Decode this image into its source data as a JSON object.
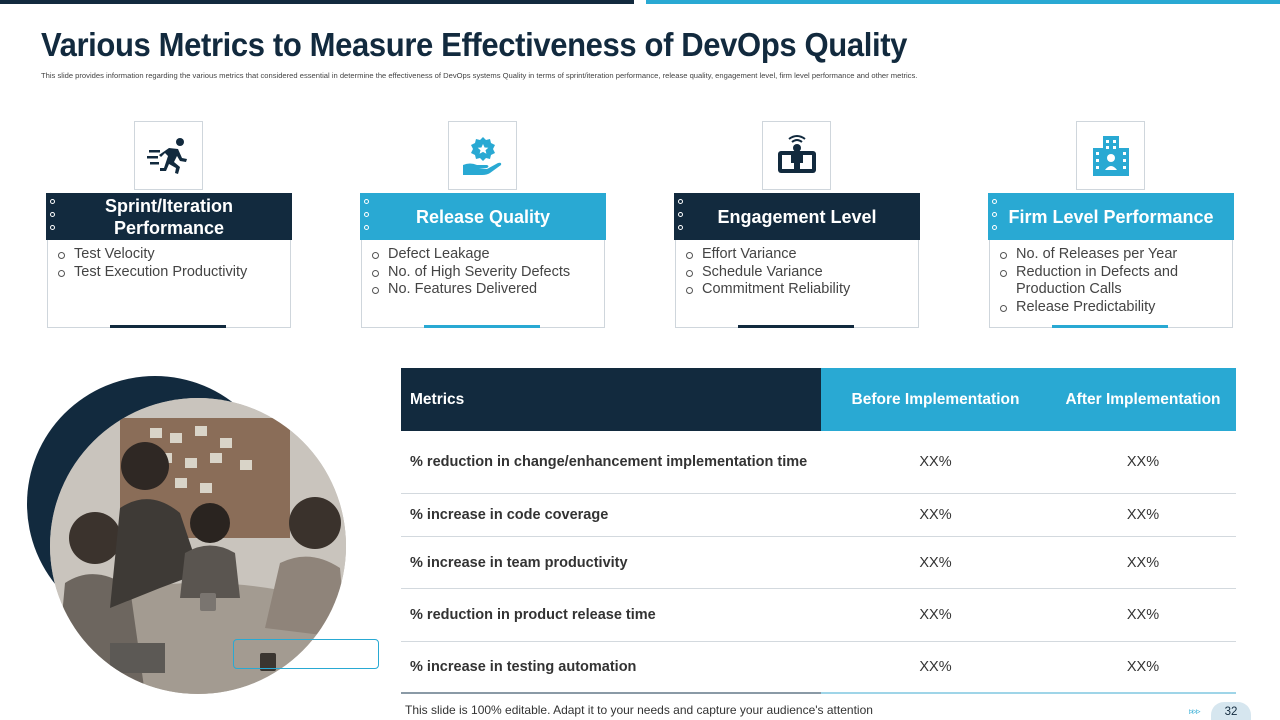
{
  "slide": {
    "title": "Various Metrics to Measure Effectiveness of DevOps Quality",
    "subtitle": "This slide provides information regarding the various metrics that considered essential in determine the effectiveness of DevOps  systems Quality in terms of sprint/iteration performance, release quality, engagement level, firm level performance and other metrics.",
    "footer_note": "This slide is 100% editable. Adapt it to your needs and capture your audience's attention",
    "page_number": "32",
    "nav_arrows": "▹▹▹"
  },
  "colors": {
    "dark": "#122a3e",
    "accent": "#29a9d3"
  },
  "cards": [
    {
      "title": "Sprint/Iteration Performance",
      "icon": "running-person-icon",
      "style": "dark",
      "items": [
        "Test Velocity",
        "Test Execution Productivity"
      ]
    },
    {
      "title": "Release Quality",
      "icon": "hand-badge-icon",
      "style": "light",
      "items": [
        "Defect Leakage",
        "No. of High Severity Defects",
        "No. Features Delivered"
      ]
    },
    {
      "title": "Engagement Level",
      "icon": "person-device-icon",
      "style": "dark",
      "items": [
        "Effort Variance",
        "Schedule Variance",
        "Commitment Reliability"
      ]
    },
    {
      "title": "Firm Level Performance",
      "icon": "building-icon",
      "style": "light",
      "items": [
        "No. of Releases per Year",
        "Reduction in Defects and Production Calls",
        "Release Predictability"
      ]
    }
  ],
  "table": {
    "headers": [
      "Metrics",
      "Before Implementation",
      "After Implementation"
    ],
    "rows": [
      {
        "metric": "% reduction in change/enhancement implementation time",
        "before": "XX%",
        "after": "XX%"
      },
      {
        "metric": "% increase in code coverage",
        "before": "XX%",
        "after": "XX%"
      },
      {
        "metric": "% increase in team productivity",
        "before": "XX%",
        "after": "XX%"
      },
      {
        "metric": "% reduction in product release time",
        "before": "XX%",
        "after": "XX%"
      },
      {
        "metric": "% increase in testing automation",
        "before": "XX%",
        "after": "XX%"
      }
    ]
  }
}
